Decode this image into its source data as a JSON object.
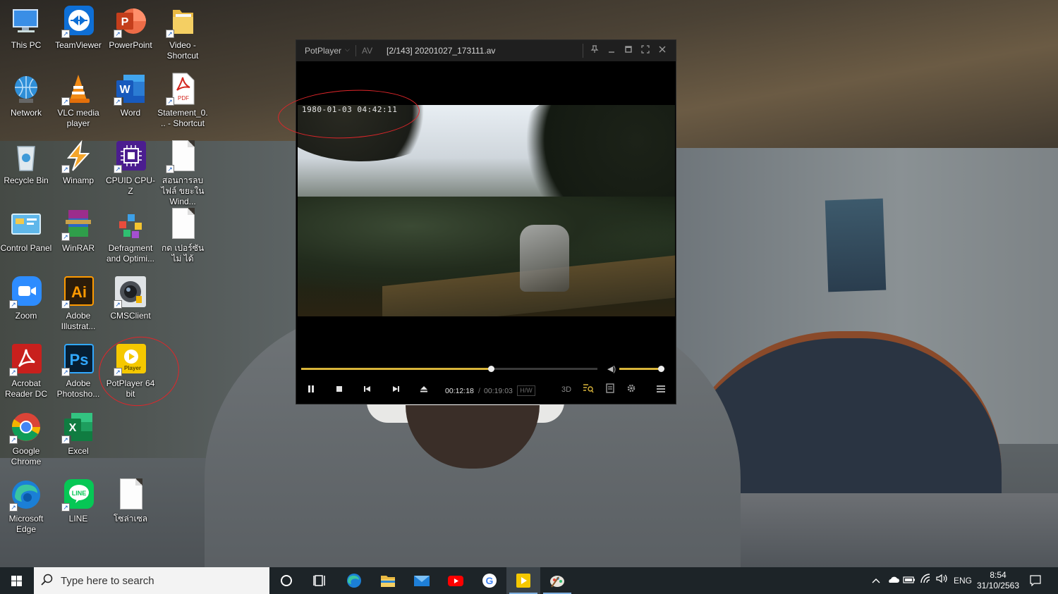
{
  "desktop": {
    "icons": [
      {
        "label": "This PC",
        "icon": "computer-icon"
      },
      {
        "label": "TeamViewer",
        "icon": "teamviewer-icon"
      },
      {
        "label": "PowerPoint",
        "icon": "powerpoint-icon"
      },
      {
        "label": "Video - Shortcut",
        "icon": "folder-icon"
      },
      {
        "label": "Network",
        "icon": "network-globe-icon"
      },
      {
        "label": "VLC media player",
        "icon": "vlc-cone-icon"
      },
      {
        "label": "Word",
        "icon": "word-icon"
      },
      {
        "label": "Statement_0... - Shortcut",
        "icon": "pdf-icon"
      },
      {
        "label": "Recycle Bin",
        "icon": "recycle-bin-icon"
      },
      {
        "label": "Winamp",
        "icon": "winamp-icon"
      },
      {
        "label": "CPUID CPU-Z",
        "icon": "cpuz-icon"
      },
      {
        "label": "สอนการลบไฟล์ ขยะใน Wind...",
        "icon": "document-icon"
      },
      {
        "label": "Control Panel",
        "icon": "control-panel-icon"
      },
      {
        "label": "WinRAR",
        "icon": "winrar-icon"
      },
      {
        "label": "Defragment and Optimi...",
        "icon": "defrag-icon"
      },
      {
        "label": "กด เปอร์ซันไม่ ได้",
        "icon": "document-icon"
      },
      {
        "label": "Zoom",
        "icon": "zoom-camera-icon"
      },
      {
        "label": "Adobe Illustrat...",
        "icon": "illustrator-icon"
      },
      {
        "label": "CMSClient",
        "icon": "cmsclient-camera-icon"
      },
      {
        "label": "Acrobat Reader DC",
        "icon": "acrobat-icon"
      },
      {
        "label": "Adobe Photosho...",
        "icon": "photoshop-icon"
      },
      {
        "label": "PotPlayer 64 bit",
        "icon": "potplayer-icon"
      },
      {
        "label": "Google Chrome",
        "icon": "chrome-icon"
      },
      {
        "label": "Excel",
        "icon": "excel-icon"
      },
      {
        "label": "Microsoft Edge",
        "icon": "edge-icon"
      },
      {
        "label": "LINE",
        "icon": "line-icon"
      },
      {
        "label": "โซล่าเซล",
        "icon": "document-icon"
      }
    ]
  },
  "player": {
    "brand": "PotPlayer",
    "format_tag": "AV",
    "file_title": "[2/143] 20201027_173111.av",
    "timestamp_overlay": "1980-01-03  04:42:11",
    "current_time": "00:12:18",
    "time_separator": "/",
    "total_time": "00:19:03",
    "hw_badge": "H/W",
    "mode_3d": "3D",
    "seek_progress": 0.64,
    "volume_level": 0.92,
    "accent_color": "#d8b43a"
  },
  "taskbar": {
    "search_placeholder": "Type here to search",
    "language": "ENG",
    "time": "8:54",
    "date": "31/10/2563"
  }
}
